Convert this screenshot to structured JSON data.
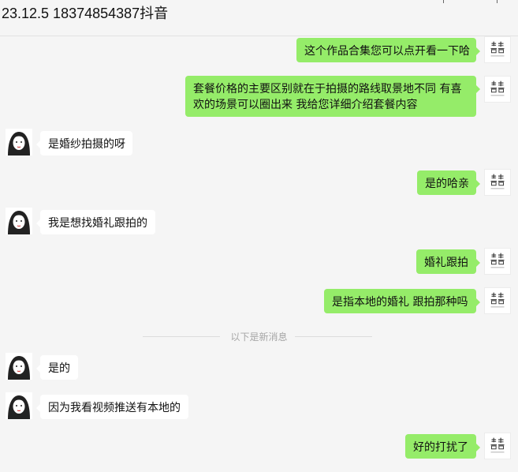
{
  "window": {
    "title": "23.12.5 18374854387抖音"
  },
  "colors": {
    "self_bubble": "#95ec69",
    "other_bubble": "#ffffff",
    "background": "#f5f5f5"
  },
  "avatars": {
    "self": "studio-logo-icon",
    "other": "girl-portrait-icon"
  },
  "messages": [
    {
      "from": "self",
      "text": "这个作品合集您可以点开看一下哈"
    },
    {
      "from": "self",
      "text": "套餐价格的主要区别就在于拍摄的路线取景地不同    有喜欢的场景可以圈出来  我给您详细介绍套餐内容"
    },
    {
      "from": "other",
      "text": "是婚纱拍摄的呀"
    },
    {
      "from": "self",
      "text": "是的哈亲"
    },
    {
      "from": "other",
      "text": "我是想找婚礼跟拍的"
    },
    {
      "from": "self",
      "text": "婚礼跟拍"
    },
    {
      "from": "self",
      "text": "是指本地的婚礼 跟拍那种吗"
    },
    {
      "from": "other",
      "text": "是的"
    },
    {
      "from": "other",
      "text": "因为我看视频推送有本地的"
    },
    {
      "from": "self",
      "text": "好的打扰了"
    }
  ],
  "new_messages_divider": "以下是新消息"
}
